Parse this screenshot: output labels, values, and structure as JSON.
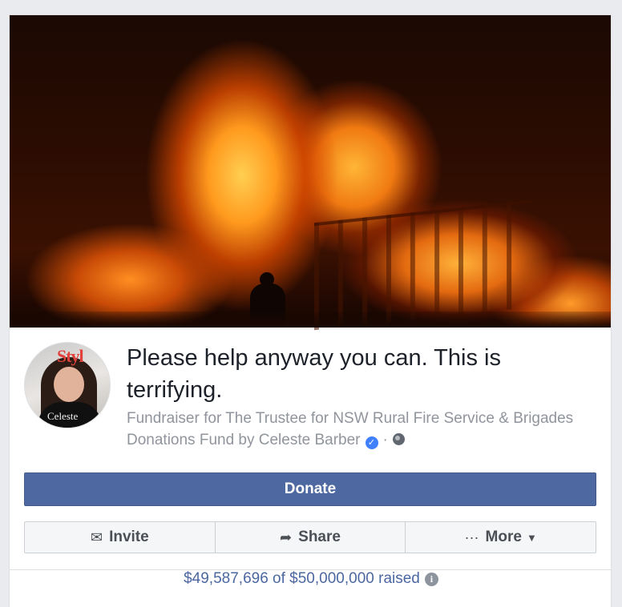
{
  "fundraiser": {
    "title": "Please help anyway you can. This is terrifying.",
    "subtitle": "Fundraiser for The Trustee for NSW Rural Fire Service & Brigades Donations Fund by Celeste Barber",
    "separator": "·",
    "avatar_magazine_text": "Styl",
    "avatar_caption": "Celeste"
  },
  "actions": {
    "donate_label": "Donate",
    "invite_label": "Invite",
    "share_label": "Share",
    "more_label": "More"
  },
  "progress": {
    "raised_text": "$49,587,696 of $50,000,000 raised",
    "raised_amount": 49587696,
    "goal_amount": 50000000
  },
  "icons": {
    "invite": "envelope-icon",
    "share": "share-arrow-icon",
    "more": "ellipsis-icon",
    "verified": "verified-badge-icon",
    "privacy": "globe-icon",
    "info": "info-icon"
  },
  "colors": {
    "donate_button": "#4e69a2",
    "link_text": "#4b67a1",
    "verified": "#4080ff"
  }
}
